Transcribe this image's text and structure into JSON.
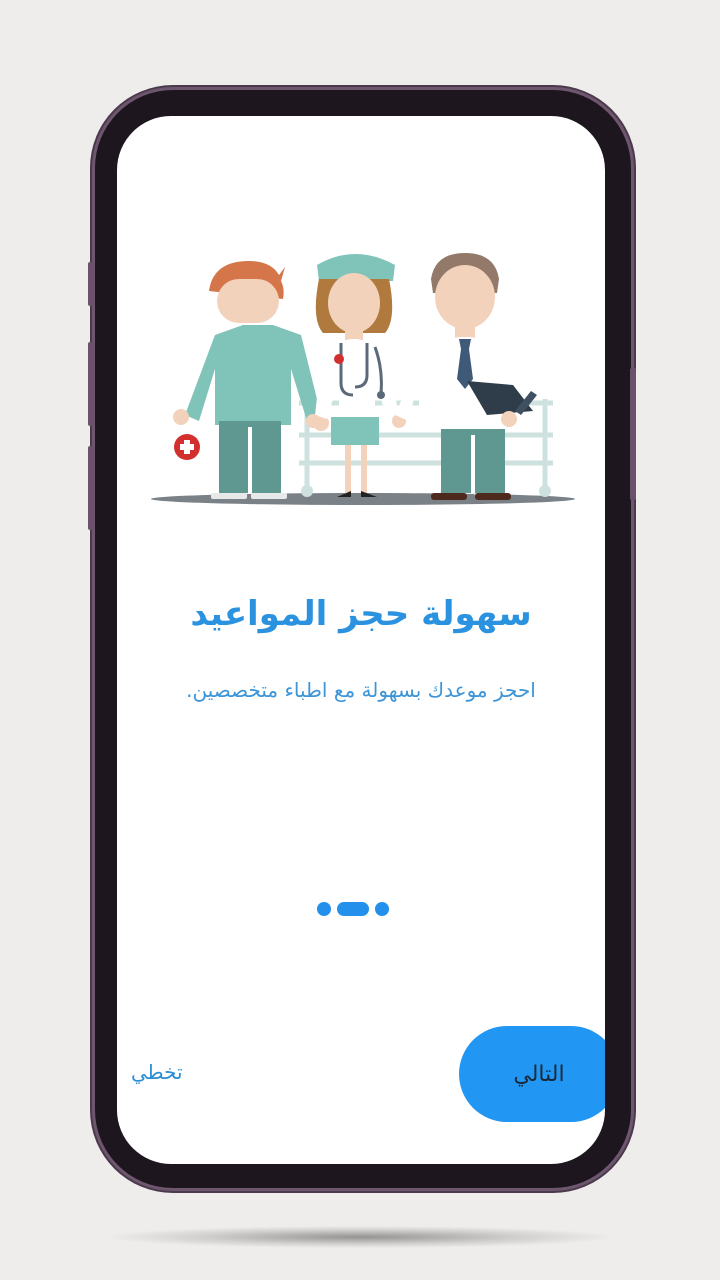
{
  "onboarding": {
    "title": "سهولة حجز المواعيد",
    "subtitle": ".احجز موعدك بسهولة مع اطباء متخصصين",
    "pagination": {
      "total": 3,
      "active": 2
    },
    "next_label": "التالي",
    "skip_label": "تخطي"
  },
  "colors": {
    "accent": "#2196f3",
    "title_text": "#2b92df",
    "phone_frame": "#6e566f"
  },
  "icons": [
    "doctors-illustration",
    "medical-cross-icon",
    "stethoscope-icon",
    "clipboard-icon"
  ]
}
